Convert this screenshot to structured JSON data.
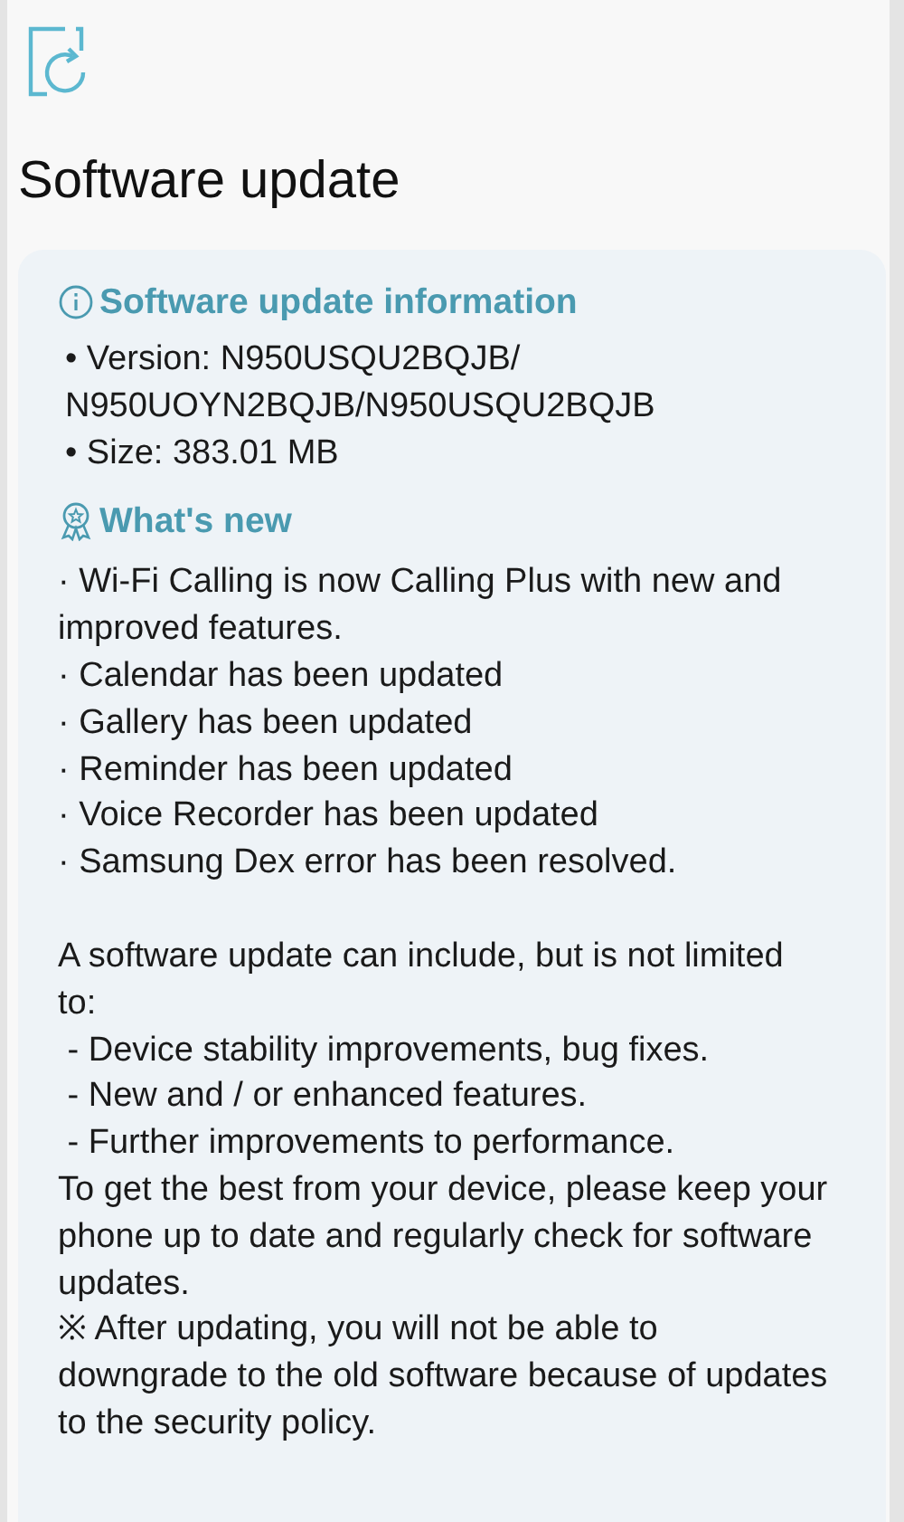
{
  "title": "Software update",
  "info": {
    "heading": "Software update information",
    "items": [
      "• Version: N950USQU2BQJB/ N950UOYN2BQJB/N950USQU2BQJB",
      "• Size: 383.01 MB"
    ]
  },
  "whats_new": {
    "heading": "What's new",
    "items": [
      "· Wi-Fi Calling is now Calling Plus with new and improved features.",
      "· Calendar has been updated",
      "· Gallery has been updated",
      "· Reminder has been updated",
      "· Voice Recorder has been updated",
      "· Samsung Dex error has been resolved."
    ]
  },
  "notice": {
    "intro": "A software update can include, but is not limited to:",
    "items": [
      " - Device stability improvements, bug fixes.",
      " - New and / or enhanced features.",
      " - Further improvements to performance."
    ],
    "closing": "To get the best from your device, please keep your phone up to date and regularly check for software updates.",
    "warning": "※ After updating, you will not be able to downgrade to the old software because of updates to the security policy."
  }
}
